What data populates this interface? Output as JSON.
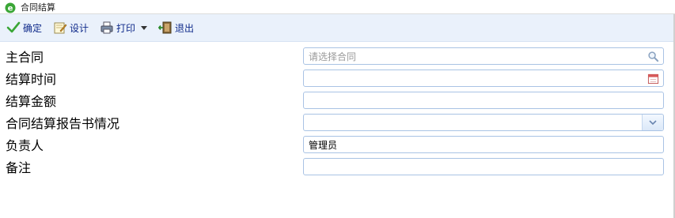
{
  "window": {
    "title": "合同结算"
  },
  "toolbar": {
    "confirm_label": "确定",
    "design_label": "设计",
    "print_label": "打印",
    "exit_label": "退出"
  },
  "form": {
    "main_contract": {
      "label": "主合同",
      "placeholder": "请选择合同",
      "value": ""
    },
    "settle_time": {
      "label": "结算时间",
      "value": ""
    },
    "settle_amount": {
      "label": "结算金额",
      "value": ""
    },
    "report_status": {
      "label": "合同结算报告书情况",
      "value": ""
    },
    "owner": {
      "label": "负责人",
      "value": "管理员"
    },
    "remark": {
      "label": "备注",
      "value": ""
    }
  },
  "colors": {
    "toolbar_bg": "#eaf1fb",
    "field_border": "#a9c3e4",
    "toolbar_text": "#0f2a8a"
  }
}
